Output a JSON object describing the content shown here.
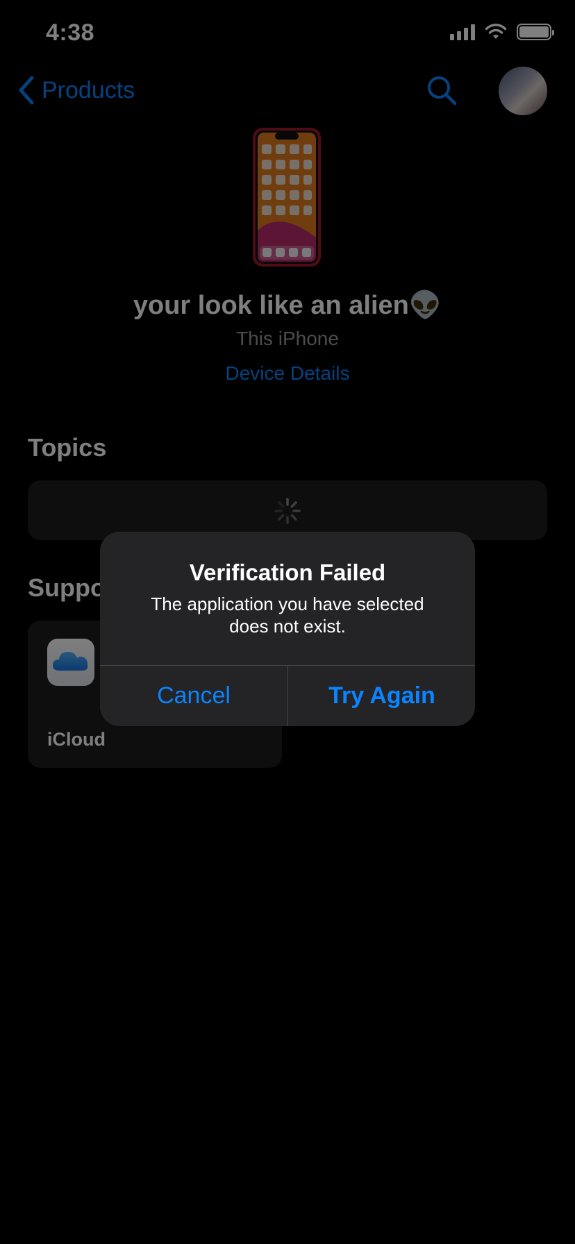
{
  "status_bar": {
    "time": "4:38"
  },
  "nav": {
    "back_label": "Products"
  },
  "device": {
    "name": "your look like an alien👽",
    "subtitle": "This iPhone",
    "details_link": "Device Details"
  },
  "topics": {
    "title": "Topics"
  },
  "support": {
    "title": "Support",
    "items": [
      {
        "label": "iCloud",
        "icon": "icloud-icon"
      }
    ]
  },
  "alert": {
    "title": "Verification Failed",
    "message": "The application you have selected does not exist.",
    "cancel_label": "Cancel",
    "confirm_label": "Try Again"
  },
  "colors": {
    "accent": "#0a84ff",
    "background": "#000000",
    "card": "#1c1c1e",
    "alert": "#242426"
  }
}
